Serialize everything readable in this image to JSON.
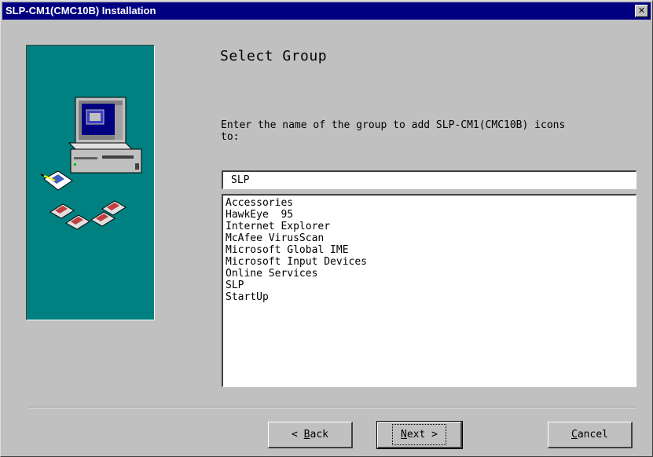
{
  "window": {
    "title": "SLP-CM1(CMC10B) Installation",
    "close_glyph": "✕"
  },
  "page": {
    "heading": "Select Group",
    "prompt": "Enter the name of the group to add SLP-CM1(CMC10B) icons\nto:"
  },
  "group_field": {
    "value": "SLP"
  },
  "group_list": {
    "items": [
      "Accessories",
      "HawkEye  95",
      "Internet Explorer",
      "McAfee VirusScan",
      "Microsoft Global IME",
      "Microsoft Input Devices",
      "Online Services",
      "SLP",
      "StartUp"
    ]
  },
  "buttons": {
    "back_prefix": "< ",
    "back_hotkey": "B",
    "back_rest": "ack",
    "next_hotkey": "N",
    "next_rest": "ext >",
    "cancel_hotkey": "C",
    "cancel_rest": "ancel"
  },
  "icons": {
    "art": "computer-with-floppy-disks-illustration",
    "close": "close-icon"
  },
  "colors": {
    "titlebar": "#000080",
    "art_background": "#008080",
    "dialog_face": "#c0c0c0"
  }
}
